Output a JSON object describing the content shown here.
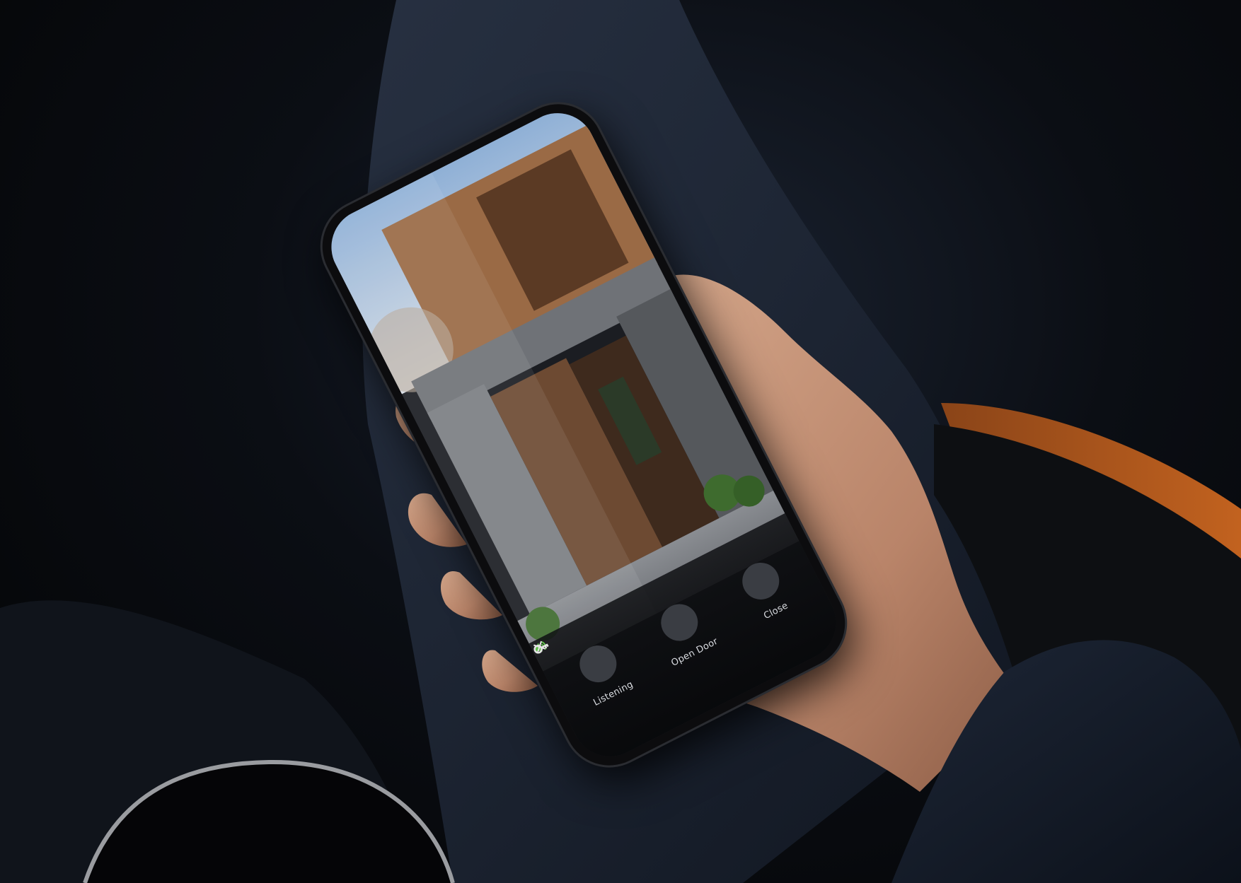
{
  "colors": {
    "listening_accent": "#5fbf4a",
    "control_bg": "#3a3d43",
    "control_icon": "#e6e6e6"
  },
  "screen": {
    "controls": [
      {
        "label": "Listening",
        "icon": "speaker-icon"
      },
      {
        "label": "Open Door",
        "icon": "key-icon"
      },
      {
        "label": "Close",
        "icon": "close-icon"
      }
    ]
  }
}
